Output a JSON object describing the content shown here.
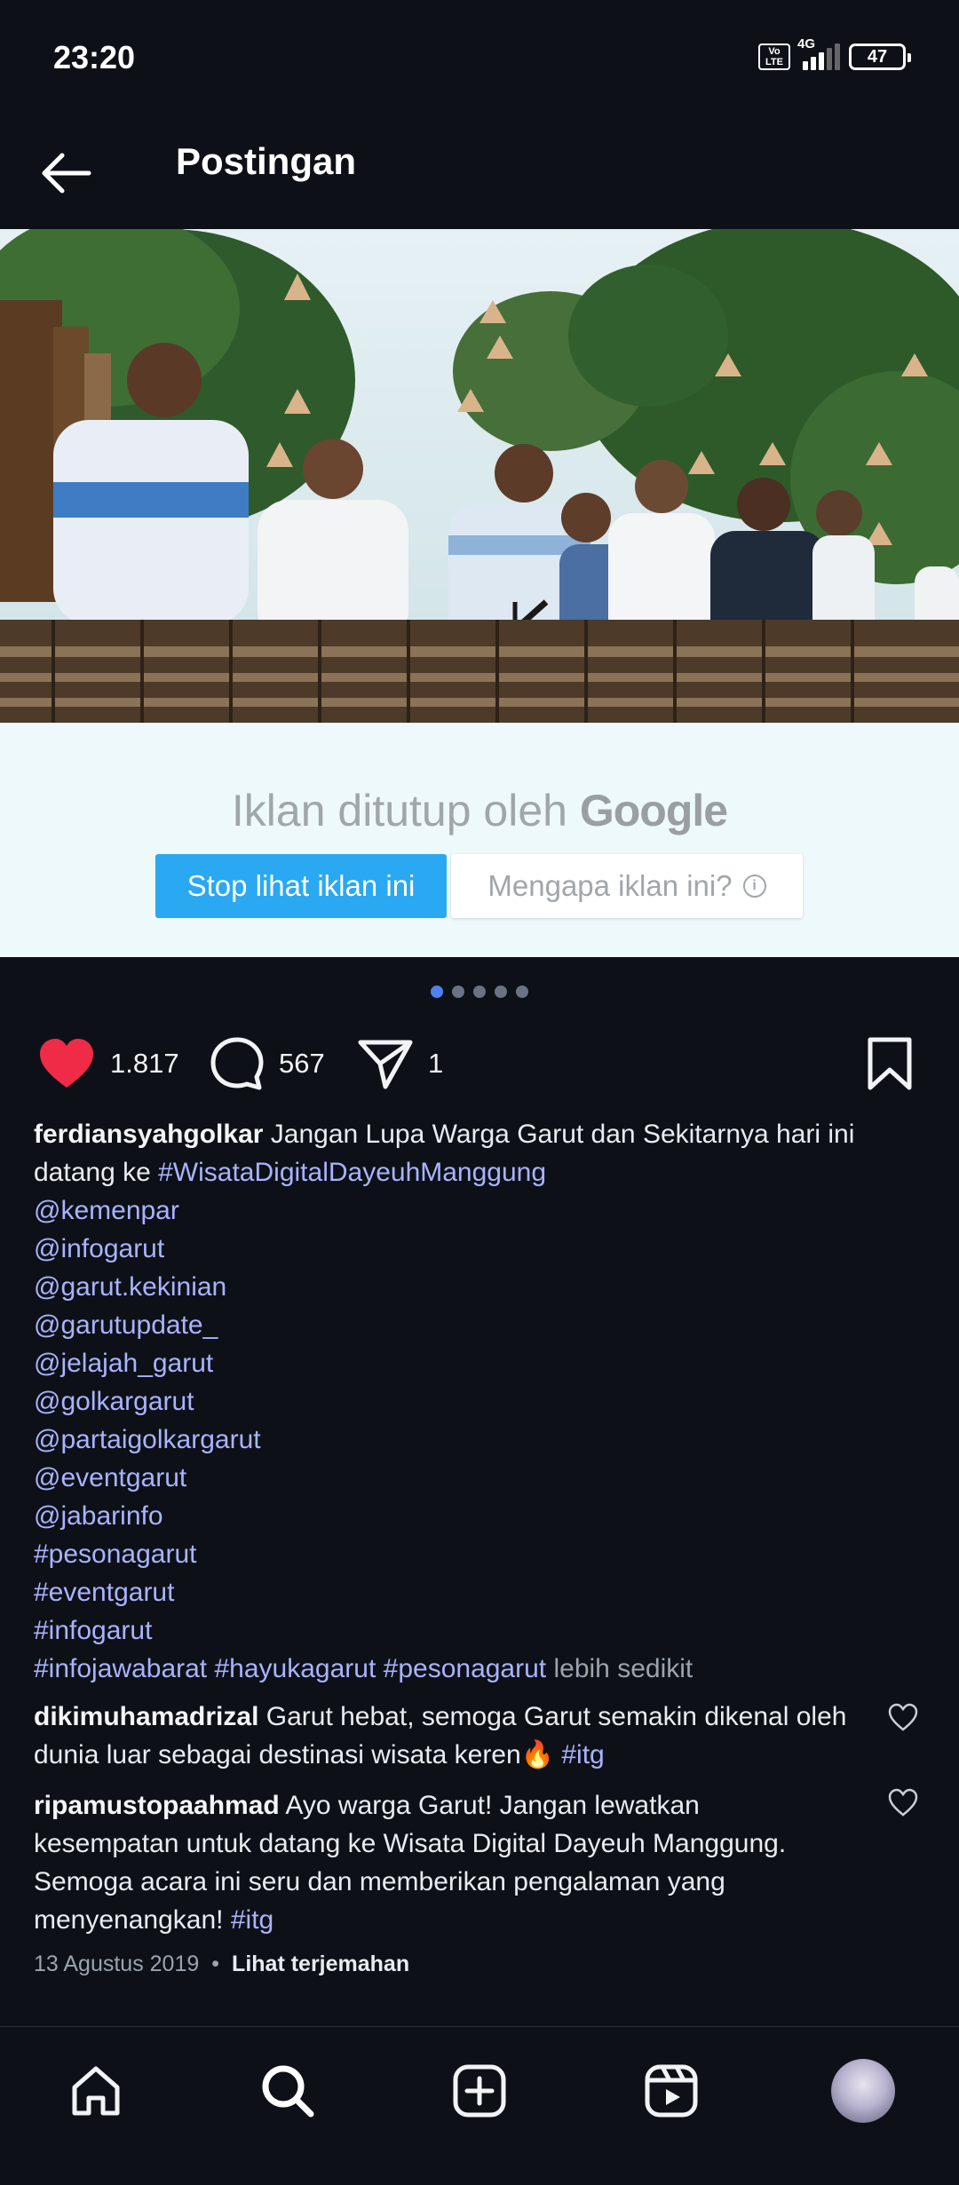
{
  "status_bar": {
    "time": "23:20",
    "volte": "Vo LTE",
    "network": "4G",
    "battery": "47"
  },
  "header": {
    "title": "Postingan"
  },
  "ad": {
    "closed_text": "Iklan ditutup oleh",
    "brand": "Google",
    "stop_button": "Stop lihat iklan ini",
    "why_button": "Mengapa iklan ini?"
  },
  "carousel": {
    "total": 5,
    "active": 1
  },
  "actions": {
    "likes": "1.817",
    "comments": "567",
    "shares": "1",
    "like_color": "#ef2b47"
  },
  "caption": {
    "username": "ferdiansyahgolkar",
    "text_line1": "Jangan Lupa Warga Garut dan Sekitarnya hari ini",
    "text_line2": "datang ke",
    "hashtag_main": "#WisataDigitalDayeuhManggung",
    "mentions": [
      "@kemenpar",
      "@infogarut",
      "@garut.kekinian",
      "@garutupdate_",
      "@jelajah_garut",
      "@golkargarut",
      "@partaigolkargarut",
      "@eventgarut",
      "@jabarinfo",
      "#pesonagarut",
      "#eventgarut",
      "#infogarut"
    ],
    "last_tags": [
      "#infojawabarat",
      "#hayukagarut",
      "#pesonagarut"
    ],
    "less_label": "lebih sedikit"
  },
  "comments": [
    {
      "username": "dikimuhamadrizal",
      "line1": "Garut hebat, semoga Garut semakin dikenal oleh",
      "line2": "dunia luar sebagai destinasi wisata keren🔥",
      "tag": "#itg"
    },
    {
      "username": "ripamustopaahmad",
      "line1": "Ayo warga Garut! Jangan lewatkan",
      "line2": "kesempatan untuk datang ke Wisata Digital Dayeuh Manggung.",
      "line3": "Semoga acara ini seru dan memberikan pengalaman yang",
      "line4": "menyenangkan!",
      "tag": "#itg"
    }
  ],
  "meta": {
    "date": "13 Agustus 2019",
    "separator": "•",
    "translate": "Lihat terjemahan"
  },
  "colors": {
    "background": "#0d1117",
    "link": "#a9b3ff",
    "ad_button": "#2aa8f2",
    "dot_active": "#4f7ff0"
  },
  "icons": [
    "back-arrow-icon",
    "heart-icon",
    "comment-icon",
    "share-icon",
    "bookmark-icon",
    "home-icon",
    "search-icon",
    "create-icon",
    "reels-icon"
  ]
}
